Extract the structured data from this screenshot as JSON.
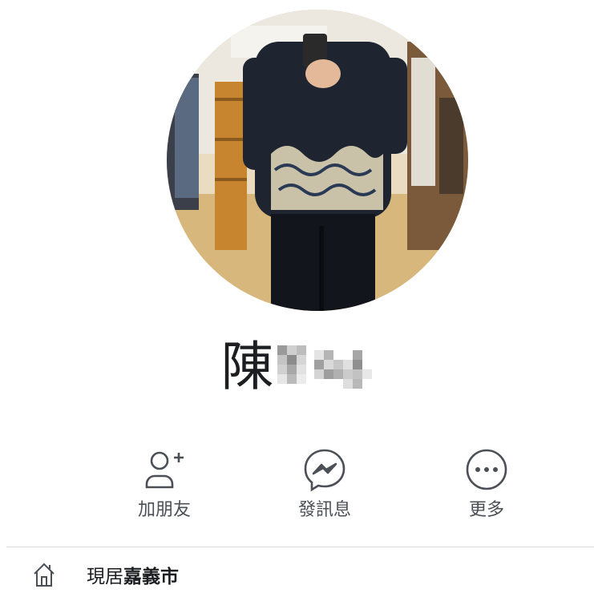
{
  "profile": {
    "name_visible": "陳"
  },
  "actions": [
    {
      "label": "加朋友",
      "icon": "add-friend-icon"
    },
    {
      "label": "發訊息",
      "icon": "messenger-icon"
    },
    {
      "label": "更多",
      "icon": "more-icon"
    }
  ],
  "info": {
    "lives_in_prefix": "現居",
    "lives_in_place": "嘉義市",
    "icon": "home-icon"
  },
  "colors": {
    "icon_gray": "#4b4f56",
    "text": "#1c1e21",
    "divider": "#dadde1"
  }
}
